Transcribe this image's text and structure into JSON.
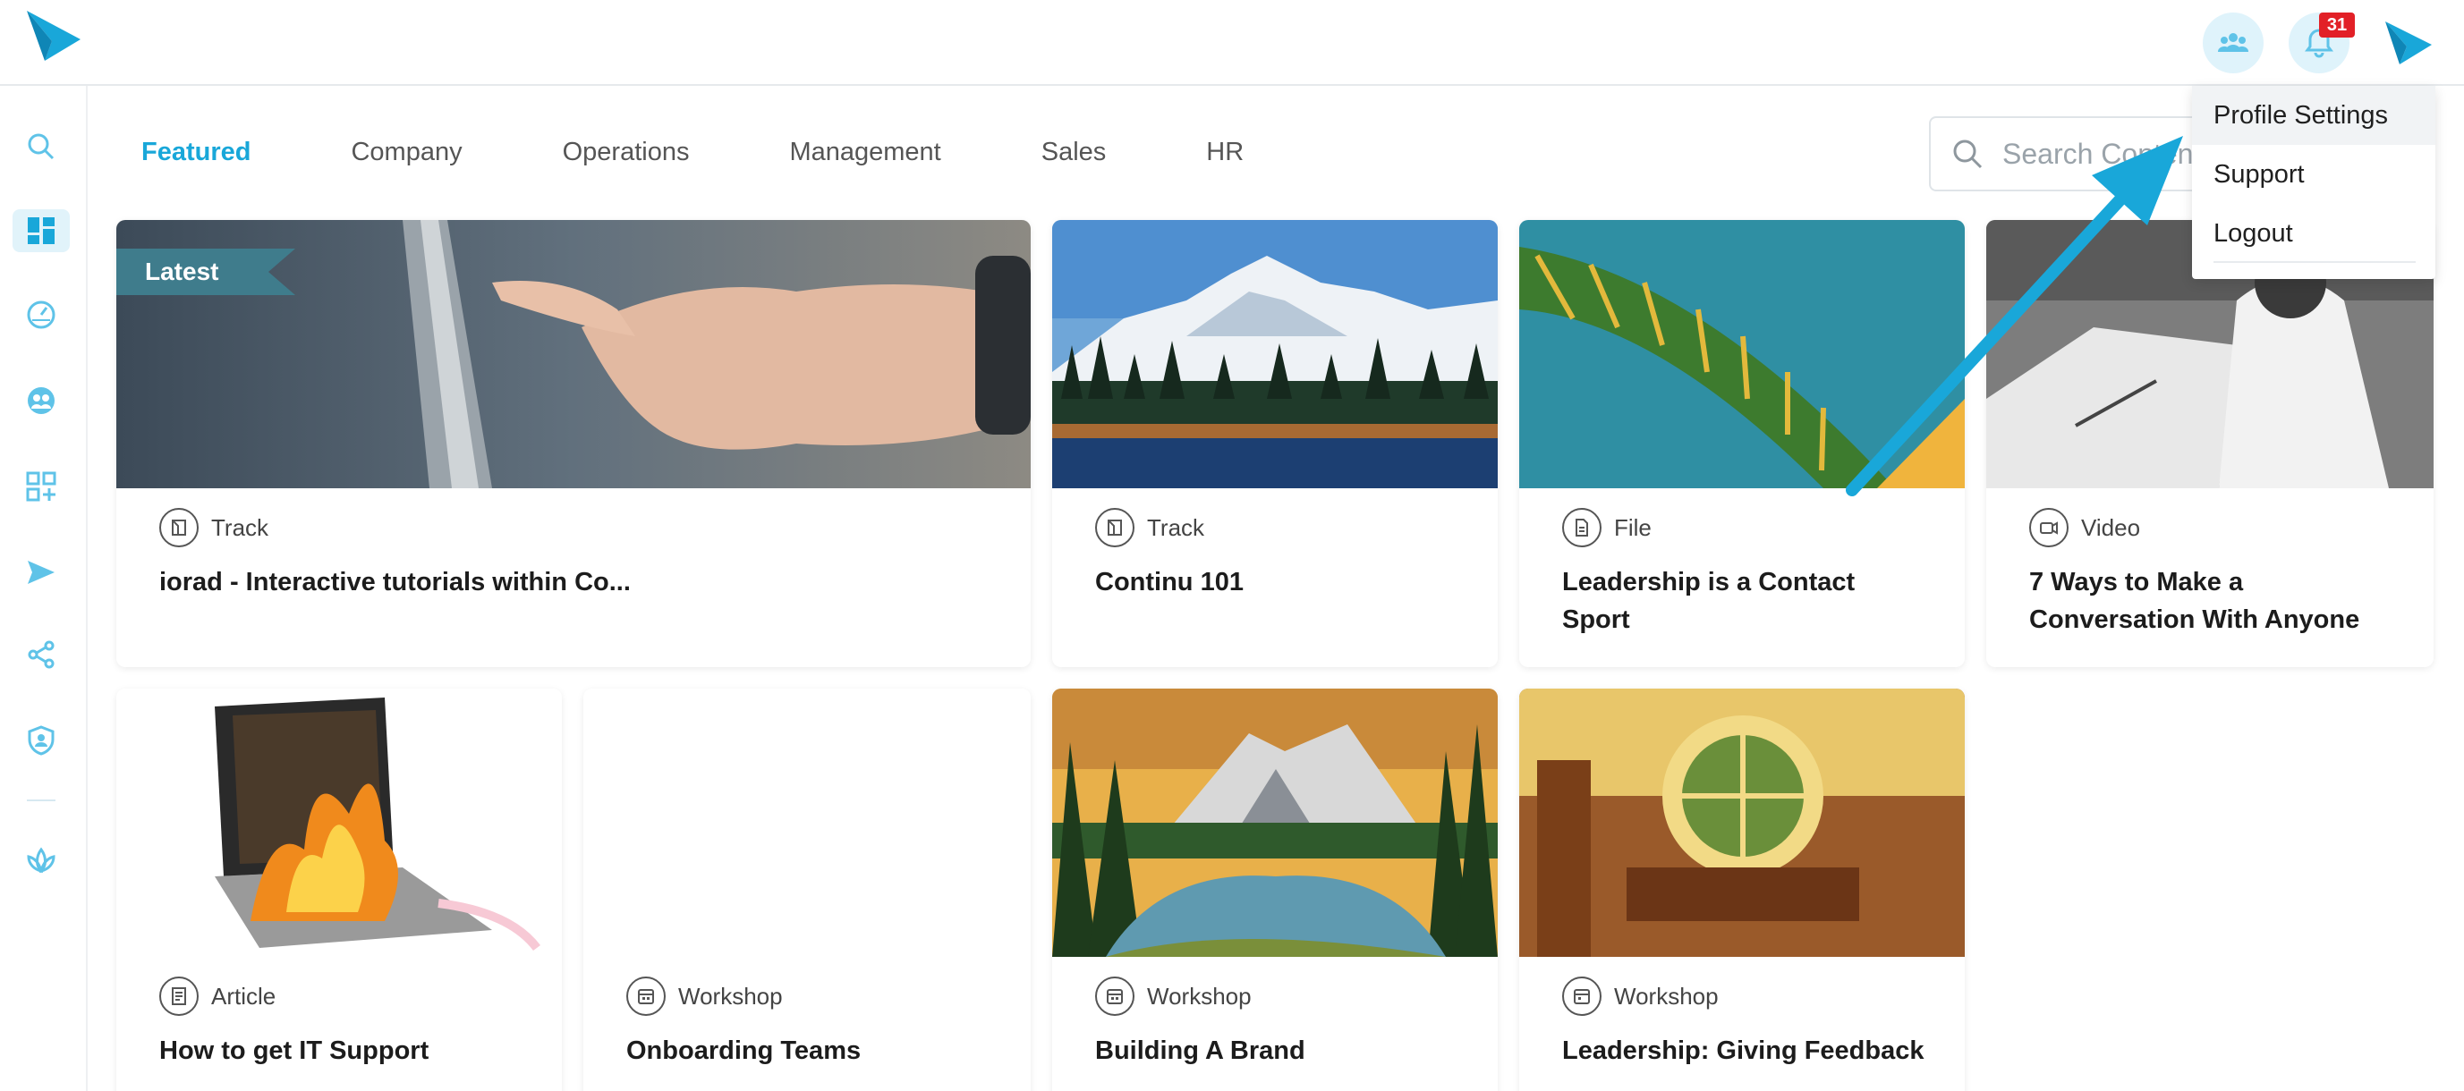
{
  "app": {
    "accent_color": "#19a7d9",
    "logo_icon": "paper-plane-logo-icon"
  },
  "header": {
    "notifications_count": "31",
    "team_icon": "team-icon",
    "bell_icon": "bell-icon"
  },
  "sidebar": {
    "items": [
      {
        "icon": "search-icon"
      },
      {
        "icon": "dashboard-icon",
        "active": true
      },
      {
        "icon": "gauge-icon"
      },
      {
        "icon": "users-icon"
      },
      {
        "icon": "add-apps-icon"
      },
      {
        "icon": "send-icon"
      },
      {
        "icon": "share-icon"
      },
      {
        "icon": "shield-user-icon"
      },
      {
        "icon": "lotus-icon"
      }
    ]
  },
  "tabs": [
    {
      "label": "Featured",
      "active": true
    },
    {
      "label": "Company"
    },
    {
      "label": "Operations"
    },
    {
      "label": "Management"
    },
    {
      "label": "Sales"
    },
    {
      "label": "HR"
    }
  ],
  "search": {
    "placeholder": "Search Content"
  },
  "cards": [
    {
      "badge": "Latest",
      "type": "Track",
      "title": "iorad - Interactive tutorials within Co..."
    },
    {
      "type": "Track",
      "title": "Continu 101"
    },
    {
      "type": "File",
      "title": "Leadership is a Contact Sport"
    },
    {
      "type": "Video",
      "title": "7 Ways to Make a Conversation With Anyone"
    },
    {
      "type": "Article",
      "title": "How to get IT Support"
    },
    {
      "type": "Workshop",
      "title": "Onboarding Teams"
    },
    {
      "type": "Workshop",
      "title": "Building A Brand"
    },
    {
      "type": "Workshop",
      "title": "Leadership: Giving Feedback"
    }
  ],
  "profile_menu": {
    "items": [
      {
        "label": "Profile Settings"
      },
      {
        "label": "Support"
      },
      {
        "label": "Logout"
      }
    ]
  }
}
